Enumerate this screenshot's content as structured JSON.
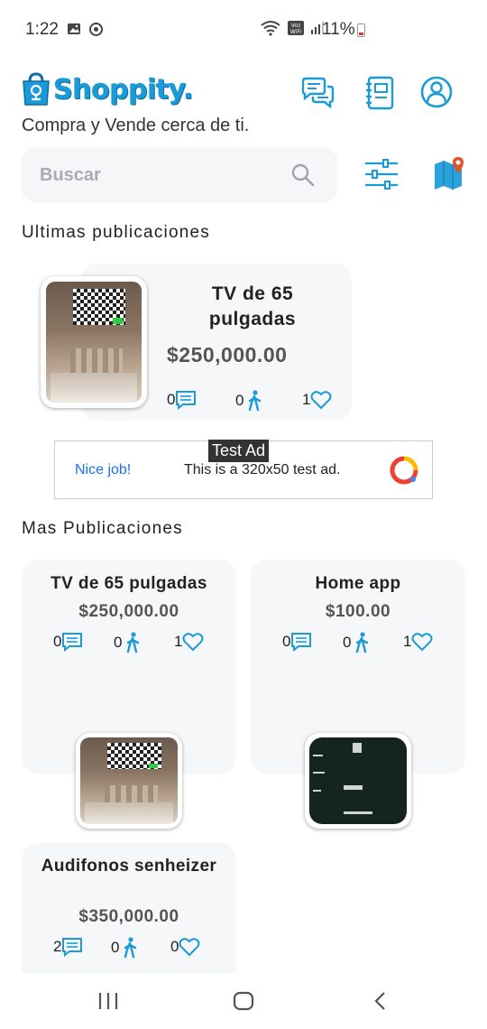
{
  "status_bar": {
    "time": "1:22",
    "battery": "11%",
    "network_label": "Voz WiFi"
  },
  "app": {
    "logo_text": "Shoppity.",
    "tagline": "Compra y Vende cerca de ti."
  },
  "search": {
    "placeholder": "Buscar"
  },
  "sections": {
    "latest": "Ultimas publicaciones",
    "more": "Mas Publicaciones"
  },
  "featured": {
    "title": "TV de 65 pulgadas",
    "price": "$250,000.00",
    "comments": "0",
    "visits": "0",
    "likes": "1"
  },
  "ad": {
    "badge": "Test Ad",
    "nice": "Nice job!",
    "text": "This is a 320x50 test ad."
  },
  "listings": [
    {
      "title": "TV de 65 pulgadas",
      "price": "$250,000.00",
      "comments": "0",
      "visits": "0",
      "likes": "1"
    },
    {
      "title": "Home app",
      "price": "$100.00",
      "comments": "0",
      "visits": "0",
      "likes": "1"
    },
    {
      "title": "Audifonos senheizer",
      "price": "$350,000.00",
      "comments": "2",
      "visits": "0",
      "likes": "0"
    }
  ],
  "colors": {
    "accent": "#1a9bd8",
    "card_bg": "#f5f7f9",
    "map_pin": "#e0532a"
  },
  "icons": {
    "header": [
      "chat-icon",
      "notebook-icon",
      "profile-icon"
    ],
    "stats": [
      "comment-icon",
      "walking-person-icon",
      "heart-icon"
    ],
    "nav": [
      "recent-apps-icon",
      "home-icon",
      "back-icon"
    ]
  }
}
